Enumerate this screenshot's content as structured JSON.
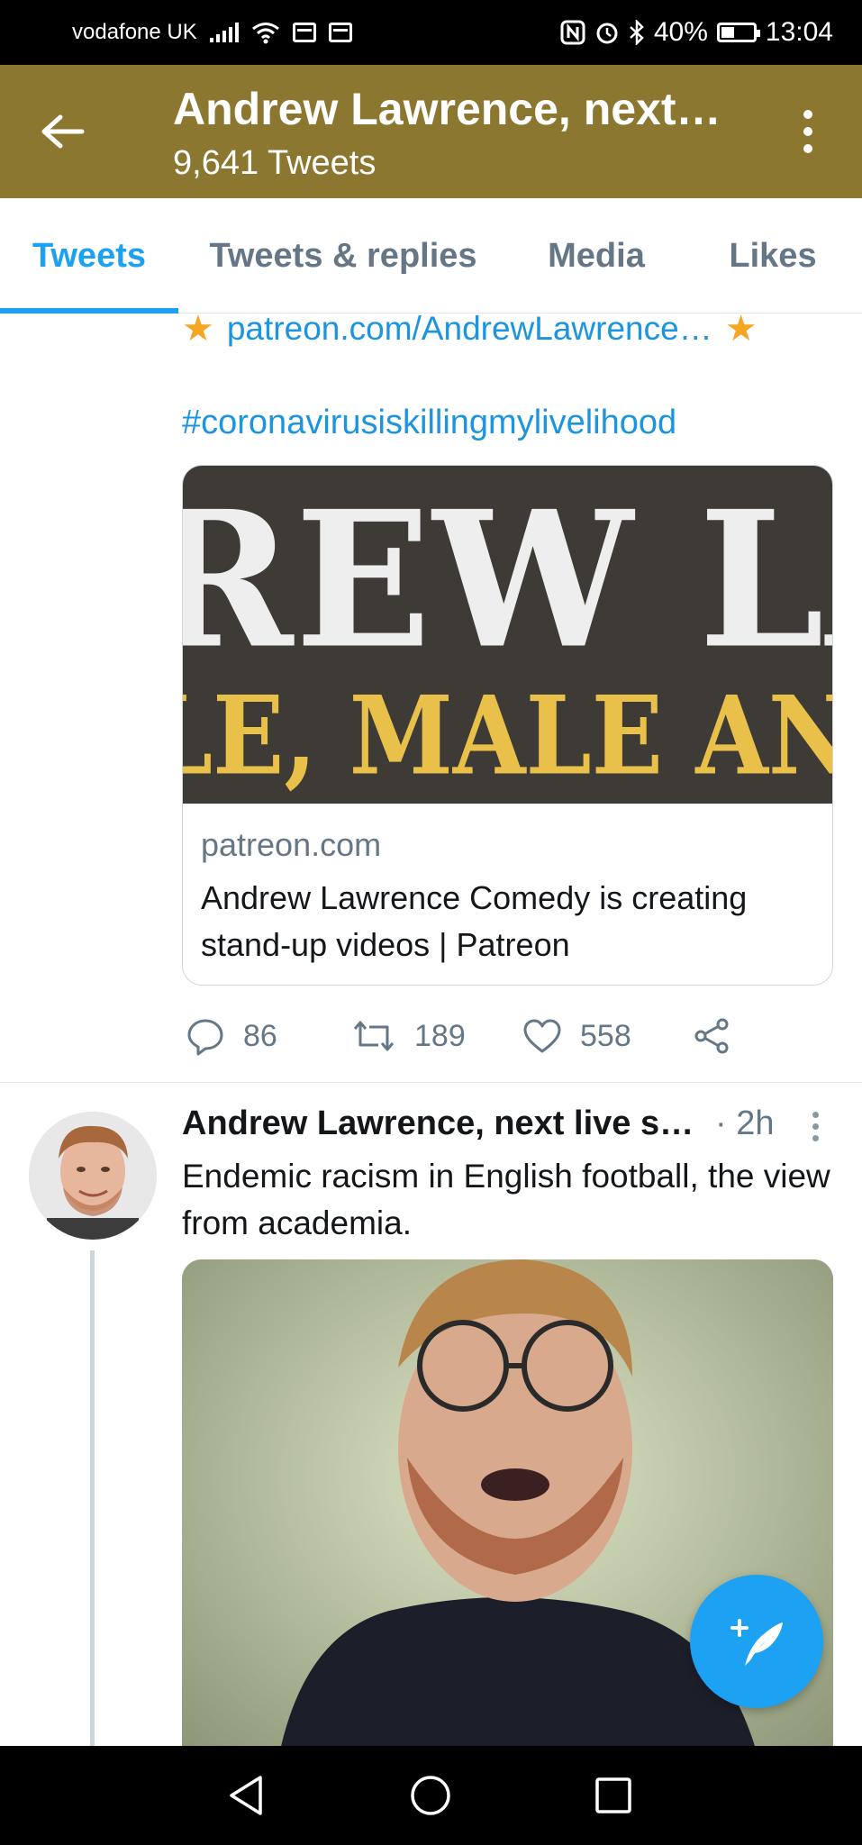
{
  "status_bar": {
    "carrier": "vodafone UK",
    "battery": "40%",
    "time": "13:04",
    "icons": [
      "signal-icon",
      "wifi-icon",
      "sim-icon",
      "sim-icon",
      "nfc-icon",
      "alarm-icon",
      "bluetooth-icon",
      "battery-icon"
    ]
  },
  "header": {
    "title": "Andrew Lawrence, next…",
    "subtitle": "9,641 Tweets",
    "bg_color": "#8b7730"
  },
  "tabs": [
    {
      "label": "Tweets",
      "active": true
    },
    {
      "label": "Tweets & replies",
      "active": false
    },
    {
      "label": "Media",
      "active": false
    },
    {
      "label": "Likes",
      "active": false
    }
  ],
  "tweet1": {
    "link_text": "patreon.com/AndrewLawrence…",
    "hashtag": "#coronavirusiskillingmylivelihood",
    "card": {
      "image_text_line1": "REW LAWRE",
      "image_text_line2": "LE, MALE AND STAL",
      "domain": "patreon.com",
      "title": "Andrew Lawrence Comedy is creating stand-up videos | Patreon"
    },
    "actions": {
      "replies": "86",
      "retweets": "189",
      "likes": "558"
    }
  },
  "tweet2": {
    "author": "Andrew Lawrence, next live s…",
    "time": "· 2h",
    "text": "Endemic racism in English football, the view from academia."
  },
  "accent_color": "#1da1f2"
}
